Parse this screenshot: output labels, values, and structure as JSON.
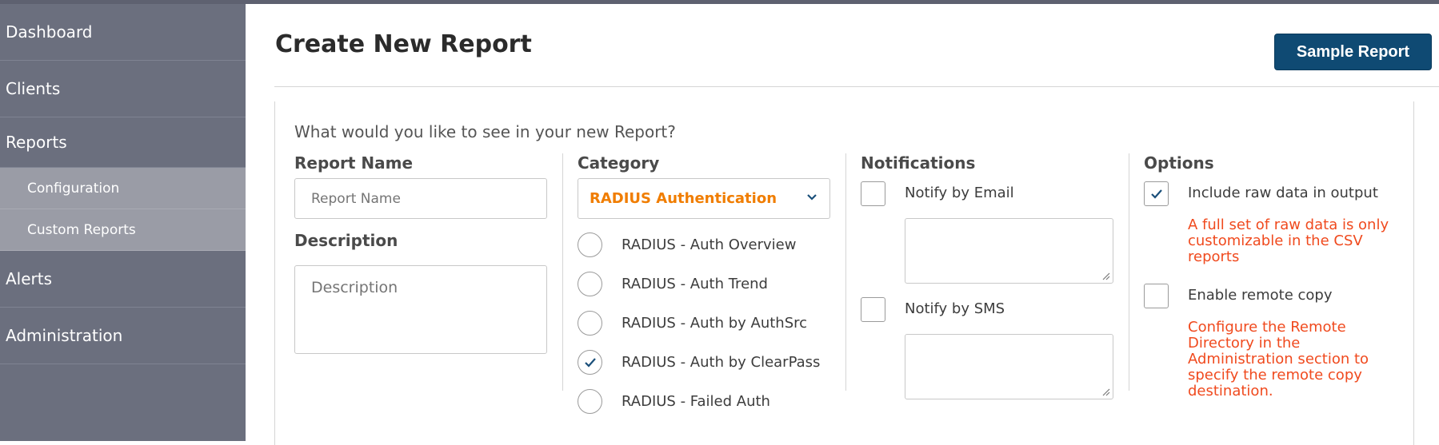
{
  "sidebar": {
    "items": [
      {
        "label": "Dashboard"
      },
      {
        "label": "Clients"
      },
      {
        "label": "Reports"
      }
    ],
    "subitems": [
      {
        "label": "Configuration"
      },
      {
        "label": "Custom Reports"
      }
    ],
    "items_after": [
      {
        "label": "Alerts"
      },
      {
        "label": "Administration"
      }
    ]
  },
  "header": {
    "title": "Create New Report",
    "sample_button": "Sample Report"
  },
  "form": {
    "prompt": "What would you like to see in your new Report?",
    "report_name": {
      "title": "Report Name",
      "placeholder": "Report Name",
      "value": ""
    },
    "description": {
      "title": "Description",
      "placeholder": "Description",
      "value": ""
    },
    "category": {
      "title": "Category",
      "selected": "RADIUS Authentication",
      "options": [
        {
          "label": "RADIUS - Auth Overview",
          "checked": false
        },
        {
          "label": "RADIUS - Auth Trend",
          "checked": false
        },
        {
          "label": "RADIUS - Auth by AuthSrc",
          "checked": false
        },
        {
          "label": "RADIUS - Auth by ClearPass",
          "checked": true
        },
        {
          "label": "RADIUS - Failed Auth",
          "checked": false
        }
      ]
    },
    "notifications": {
      "title": "Notifications",
      "email_label": "Notify by Email",
      "sms_label": "Notify by SMS",
      "email_checked": false,
      "sms_checked": false
    },
    "options": {
      "title": "Options",
      "raw_label": "Include raw data in output",
      "raw_checked": true,
      "raw_note": "A full set of raw data is only customizable in the CSV reports",
      "remote_label": "Enable remote copy",
      "remote_checked": false,
      "remote_note": "Configure the Remote Directory in the Administration section to specify the remote copy destination."
    }
  },
  "colors": {
    "sidebar_bg": "#6b6f7e",
    "submenu_bg": "#9a9ca6",
    "primary_button": "#0f4a73",
    "category_accent": "#f07d00",
    "warning_text": "#f04a1e",
    "check_color": "#1a4f7a"
  },
  "icons": {
    "chevron": "chevron-down-icon",
    "check": "check-icon",
    "resize": "resize-handle-icon"
  }
}
